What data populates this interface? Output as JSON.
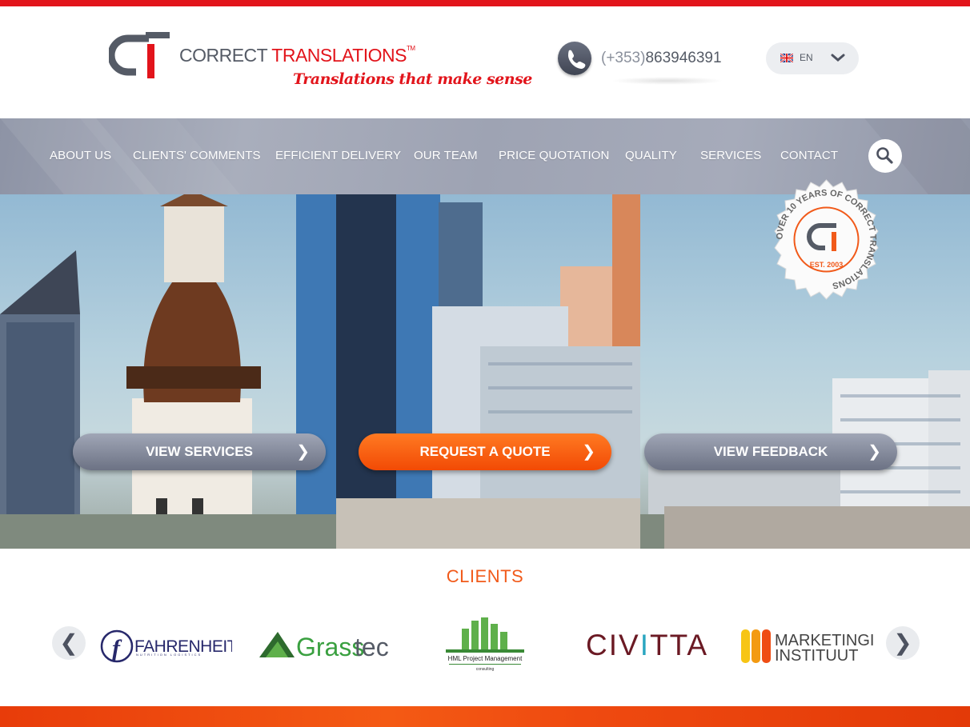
{
  "header": {
    "brand_left": "CORRECT ",
    "brand_right": "TRANSLATIONS",
    "brand_tm": "TM",
    "tagline": "Translations that make sense",
    "phone_prefix": "(+353)",
    "phone_number": "863946391",
    "language": "EN"
  },
  "nav": {
    "items": [
      {
        "label": "ABOUT US"
      },
      {
        "label": "CLIENTS' COMMENTS"
      },
      {
        "label": "EFFICIENT DELIVERY"
      },
      {
        "label": "OUR TEAM"
      },
      {
        "label": "PRICE QUOTATION"
      },
      {
        "label": "QUALITY"
      },
      {
        "label": "SERVICES"
      },
      {
        "label": "CONTACT"
      }
    ]
  },
  "hero": {
    "badge_ring_text": "OVER 10 YEARS OF CORRECT TRANSLATIONS",
    "badge_est": "EST. 2003",
    "buttons": {
      "services": "VIEW SERVICES",
      "quote": "REQUEST A QUOTE",
      "feedback": "VIEW FEEDBACK",
      "arrow": "❯"
    }
  },
  "clients": {
    "title": "CLIENTS",
    "prev": "❮",
    "next": "❯",
    "logos": {
      "fahrenheit": "FAHRENHEIT",
      "fahrenheit_sub": "NUTRITION LOGISTICS",
      "grasstec_a": "Grass",
      "grasstec_b": "tec",
      "hml": "HML Project Management",
      "hml_sub": "consulting",
      "civitta_a": "CIV",
      "civitta_i": "I",
      "civitta_b": "TTA",
      "marketing_1": "MARKETINGI",
      "marketing_2": "INSTITUUT"
    }
  },
  "colors": {
    "accent_red": "#e2141b",
    "accent_orange": "#f15a1a",
    "nav_grey": "#9ea3b3",
    "text_grey": "#555b66"
  }
}
